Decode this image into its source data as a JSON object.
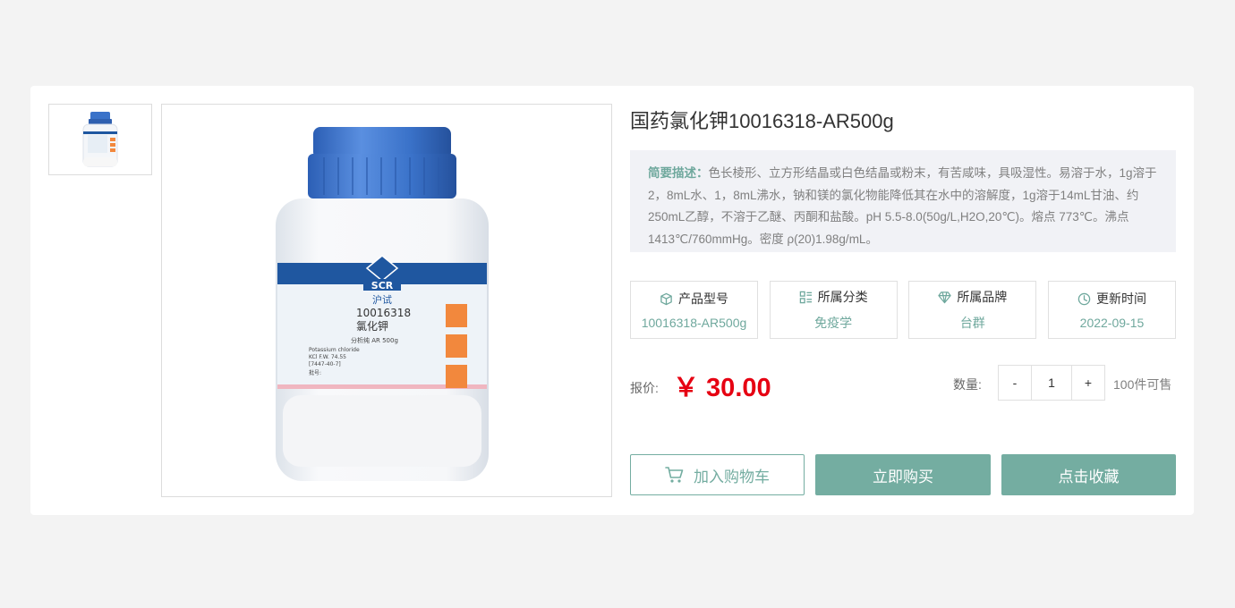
{
  "product": {
    "title": "国药氯化钾10016318-AR500g",
    "description_label": "简要描述：",
    "description": "色长棱形、立方形结晶或白色结晶或粉末，有苦咸味，具吸湿性。易溶于水，1g溶于2，8mL水、1，8mL沸水，钠和镁的氯化物能降低其在水中的溶解度，1g溶于14mL甘油、约250mL乙醇，不溶于乙醚、丙酮和盐酸。pH 5.5-8.0(50g/L,H2O,20℃)。熔点 773℃。沸点 1413℃/760mmHg。密度 ρ(20)1.98g/mL。"
  },
  "bottle_label": {
    "brand": "SCR",
    "brand_cn": "沪试",
    "code": "10016318",
    "name_cn": "氯化钾",
    "grade": "分析纯  AR  500g",
    "name_en": "Potassium chloride",
    "formula": "KCl  F.W. 74.55",
    "cas": "[7447-40-7]",
    "batch": "批号:"
  },
  "attributes": [
    {
      "label": "产品型号",
      "value": "10016318-AR500g",
      "icon": "cube-icon"
    },
    {
      "label": "所属分类",
      "value": "免疫学",
      "icon": "category-grid-icon"
    },
    {
      "label": "所属品牌",
      "value": "台群",
      "icon": "diamond-icon"
    },
    {
      "label": "更新时间",
      "value": "2022-09-15",
      "icon": "clock-icon"
    }
  ],
  "price": {
    "label": "报价:",
    "value": "￥ 30.00"
  },
  "quantity": {
    "label": "数量:",
    "minus": "-",
    "value": "1",
    "plus": "+",
    "stock": "100件可售"
  },
  "actions": {
    "cart": "加入购物车",
    "buy": "立即购买",
    "favorite": "点击收藏"
  },
  "colors": {
    "accent": "#74ada1",
    "price": "#e60012",
    "cap": "#3a72c9"
  }
}
